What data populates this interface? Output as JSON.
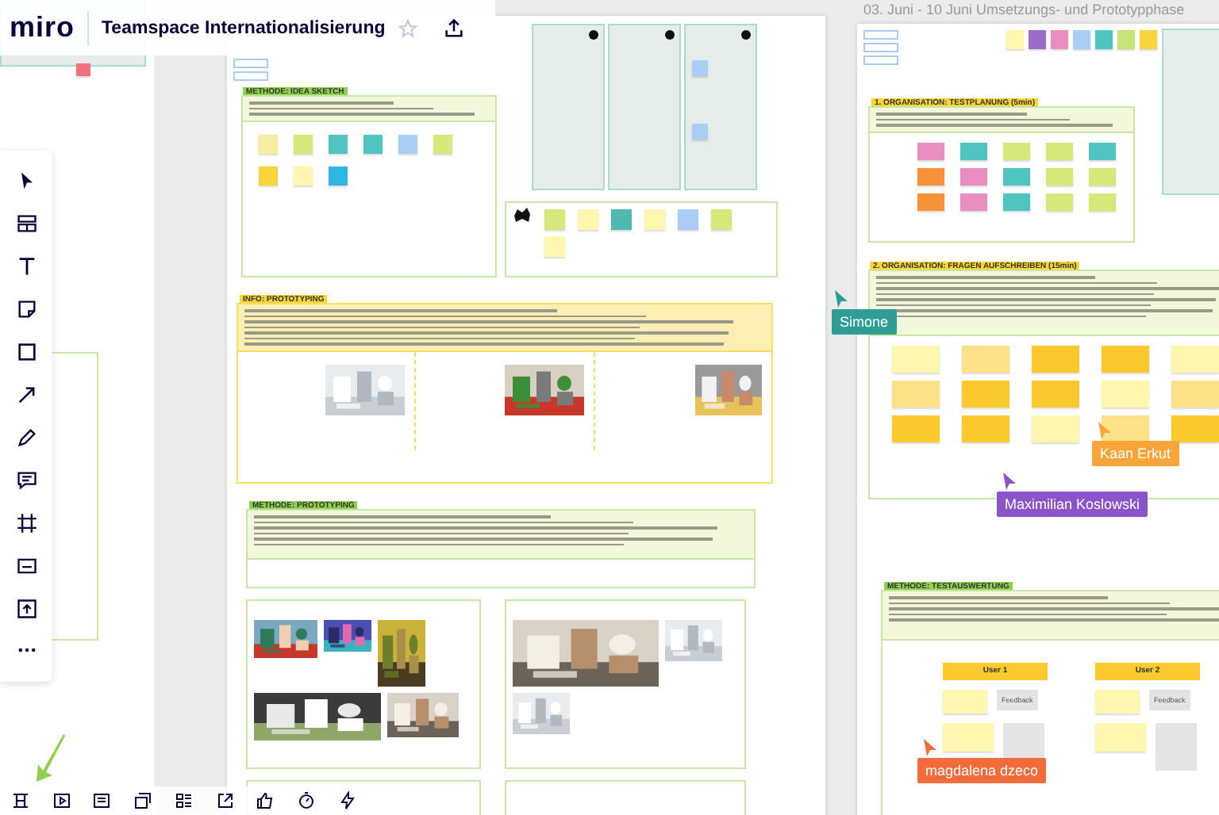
{
  "header": {
    "logo": "miro",
    "title": "Teamspace Internationalisierung",
    "starred": false
  },
  "right_board_heading": "03. Juni - 10 Juni Umsetzungs- und Prototypphase",
  "middle_board": {
    "idea_sketch": {
      "label": "METHODE: IDEA SKETCH",
      "stickies": [
        {
          "color": "#f5ee9e"
        },
        {
          "color": "#d6e87a"
        },
        {
          "color": "#4fc4c0"
        },
        {
          "color": "#4fc4c0"
        },
        {
          "color": "#a9cdf5"
        },
        {
          "color": "#d6e87a"
        },
        {
          "color": "#f5d43c"
        },
        {
          "color": "#fff6b0"
        },
        {
          "color": "#2fb6e0"
        }
      ]
    },
    "reactions": {
      "stickies": [
        {
          "color": "#d6e87a"
        },
        {
          "color": "#fff6b0"
        },
        {
          "color": "#4fb8b2"
        },
        {
          "color": "#fff6b0"
        },
        {
          "color": "#a9cdf5"
        },
        {
          "color": "#d6e87a"
        },
        {
          "color": "#fff6b0"
        }
      ]
    },
    "info": {
      "label": "INFO: PROTOTYPING"
    },
    "method": {
      "label": "METHODE: PROTOTYPING"
    }
  },
  "right_board": {
    "palette": [
      {
        "color": "#fff6b0"
      },
      {
        "color": "#9b6bc8"
      },
      {
        "color": "#e98fc0"
      },
      {
        "color": "#a9cdf5"
      },
      {
        "color": "#4fc4c0"
      },
      {
        "color": "#c6e377"
      },
      {
        "color": "#f5d43c"
      }
    ],
    "planning": {
      "label": "1. ORGANISATION: TESTPLANUNG (5min)",
      "stickies": [
        {
          "color": "#e98fc0"
        },
        {
          "color": "#4fc4c0"
        },
        {
          "color": "#d6e87a"
        },
        {
          "color": "#d6e87a"
        },
        {
          "color": "#4fc4c0"
        },
        {
          "color": "#f7923a"
        },
        {
          "color": "#e98fc0"
        },
        {
          "color": "#4fc4c0"
        },
        {
          "color": "#d6e87a"
        },
        {
          "color": "#d6e87a"
        },
        {
          "color": "#f7923a"
        },
        {
          "color": "#e98fc0"
        },
        {
          "color": "#4fc4c0"
        },
        {
          "color": "#d6e87a"
        },
        {
          "color": "#d6e87a"
        }
      ]
    },
    "questions": {
      "label": "2. ORGANISATION: FRAGEN AUFSCHREIBEN (15min)",
      "stickies": [
        {
          "color": "#fff6b0"
        },
        {
          "color": "#fde28a"
        },
        {
          "color": "#f9c92e"
        },
        {
          "color": "#f9c92e"
        },
        {
          "color": "#fff6b0"
        },
        {
          "color": "#fde28a"
        },
        {
          "color": "#f9c92e"
        },
        {
          "color": "#f9c92e"
        },
        {
          "color": "#fff6b0"
        },
        {
          "color": "#fde28a"
        },
        {
          "color": "#f9c92e"
        },
        {
          "color": "#f9c92e"
        },
        {
          "color": "#fff6b0"
        },
        {
          "color": "#fde28a"
        },
        {
          "color": "#f9c92e"
        }
      ]
    },
    "evaluation": {
      "label": "METHODE: TESTAUSWERTUNG",
      "users": [
        {
          "title": "User 1",
          "feedback": "Feedback"
        },
        {
          "title": "User 2",
          "feedback": "Feedback"
        }
      ]
    }
  },
  "cursors": [
    {
      "name": "Simone",
      "color": "#2e9e94"
    },
    {
      "name": "Kaan Erkut",
      "color": "#f9a53a"
    },
    {
      "name": "Maximilian Koslowski",
      "color": "#8a55c9"
    },
    {
      "name": "magdalena dzeco",
      "color": "#f26b3a"
    }
  ]
}
